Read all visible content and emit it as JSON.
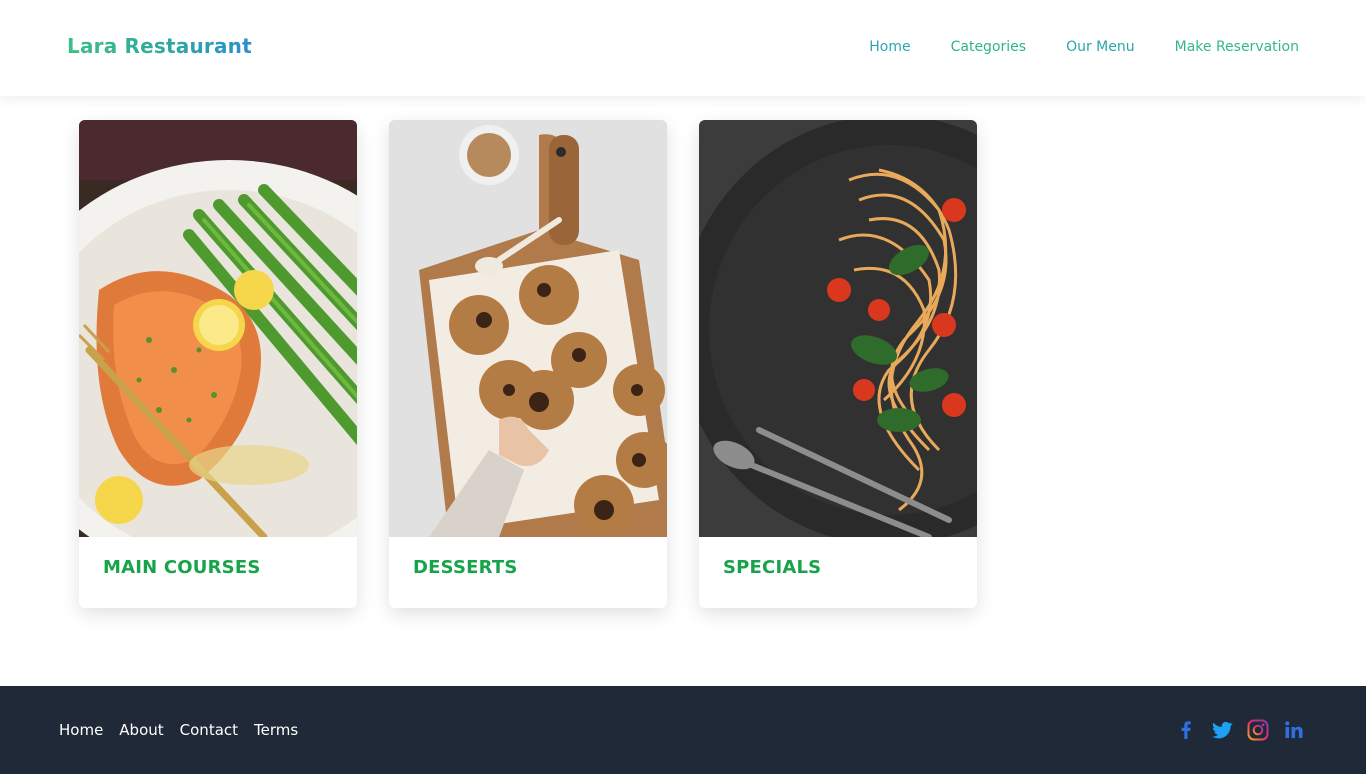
{
  "header": {
    "brand": "Lara Restaurant",
    "nav": [
      {
        "label": "Home"
      },
      {
        "label": "Categories"
      },
      {
        "label": "Our Menu"
      },
      {
        "label": "Make Reservation"
      }
    ]
  },
  "categories": [
    {
      "title": "MAIN COURSES",
      "image": "salmon-asparagus-plate"
    },
    {
      "title": "DESSERTS",
      "image": "chocolate-chip-cookies-board"
    },
    {
      "title": "SPECIALS",
      "image": "spaghetti-tomato-spinach-plate"
    }
  ],
  "footer": {
    "links": [
      {
        "label": "Home"
      },
      {
        "label": "About"
      },
      {
        "label": "Contact"
      },
      {
        "label": "Terms"
      }
    ],
    "socials": [
      "facebook-icon",
      "twitter-icon",
      "instagram-icon",
      "linkedin-icon"
    ]
  },
  "colors": {
    "brand_gradient": [
      "#3fbf86",
      "#2a8fd1"
    ],
    "category_title": "#16a34a",
    "footer_bg": "#1f2937",
    "facebook": "#2f6fe0",
    "twitter": "#1da1f2",
    "instagram": "#e1306c",
    "linkedin": "#2f6fe0"
  }
}
